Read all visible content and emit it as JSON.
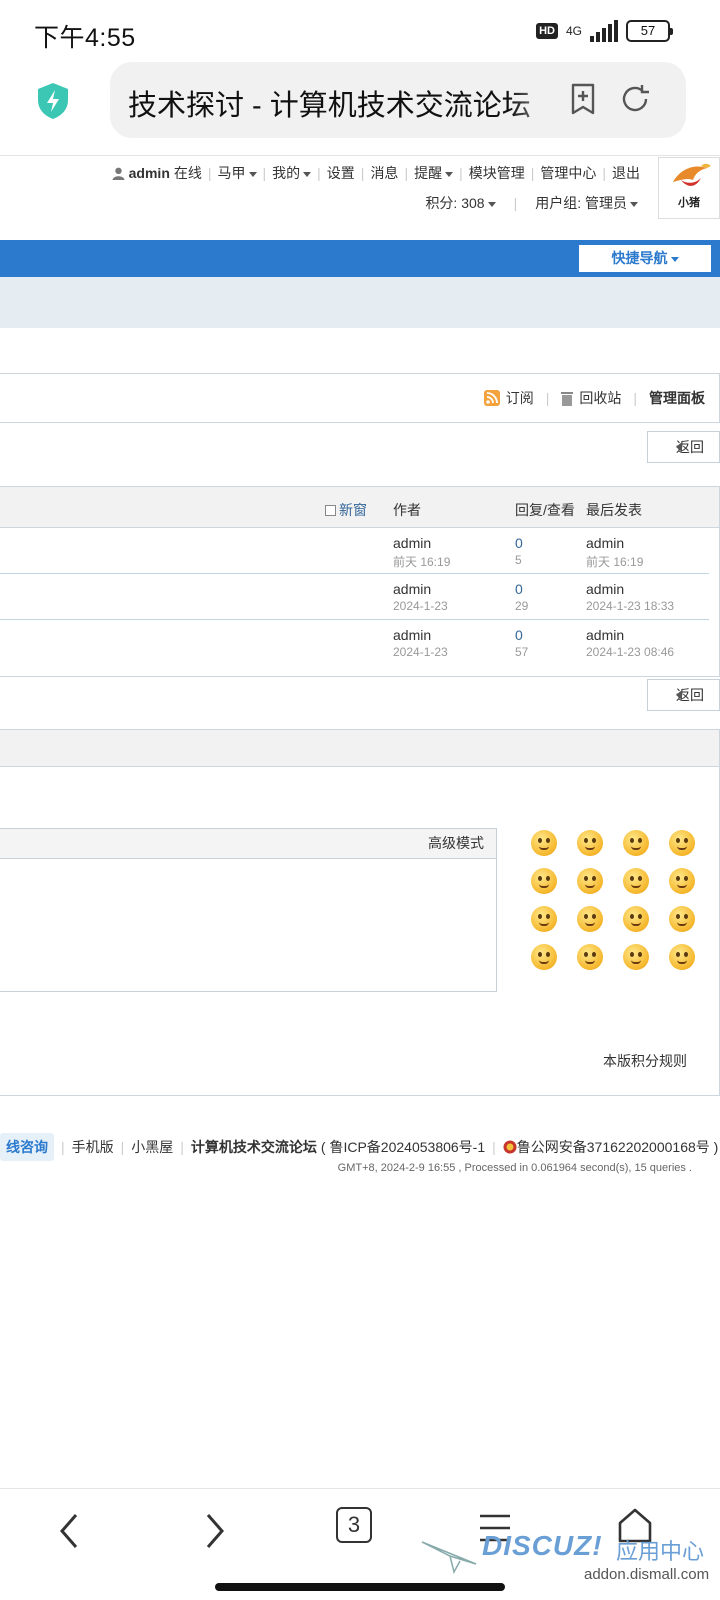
{
  "status_bar": {
    "time": "下午4:55",
    "hd": "HD",
    "network": "4G",
    "battery": "57"
  },
  "browser": {
    "url_title": "技术探讨 - 计算机技术交流论坛",
    "tab_count": "3"
  },
  "user_nav": {
    "username": "admin",
    "online": "在线",
    "items": [
      "马甲",
      "我的",
      "设置",
      "消息",
      "提醒",
      "模块管理",
      "管理中心",
      "退出"
    ],
    "points": "积分: 308",
    "usergroup": "用户组: 管理员"
  },
  "logo": {
    "text": "小猪"
  },
  "nav": {
    "quick_nav": "快捷导航"
  },
  "toolbar": {
    "subscribe": "订阅",
    "recycle": "回收站",
    "admin_panel": "管理面板"
  },
  "back_label": "返回",
  "thread_table": {
    "header": {
      "new_window": "新窗",
      "author": "作者",
      "reply_view": "回复/查看",
      "last_post": "最后发表"
    },
    "rows": [
      {
        "author": "admin",
        "author_date": "前天 16:19",
        "replies": "0",
        "views": "5",
        "last_author": "admin",
        "last_date": "前天 16:19"
      },
      {
        "author": "admin",
        "author_date": "2024-1-23",
        "replies": "0",
        "views": "29",
        "last_author": "admin",
        "last_date": "2024-1-23 18:33"
      },
      {
        "author": "admin",
        "author_date": "2024-1-23",
        "replies": "0",
        "views": "57",
        "last_author": "admin",
        "last_date": "2024-1-23 08:46"
      }
    ]
  },
  "quick_reply": {
    "advanced_mode": "高级模式",
    "rules": "本版积分规则"
  },
  "footer": {
    "consult": "线咨询",
    "mobile": "手机版",
    "blackroom": "小黑屋",
    "site_name": "计算机技术交流论坛",
    "icp": "( 鲁ICP备2024053806号-1",
    "police": "鲁公网安备37162202000168号 )",
    "stats": "GMT+8, 2024-2-9 16:55 , Processed in 0.061964 second(s), 15 queries ."
  },
  "watermark": {
    "brand": "DISCUZ!",
    "cn": "应用中心",
    "url": "addon.dismall.com"
  },
  "colors": {
    "nav_blue": "#2b7acd",
    "light_band": "#e5edf2",
    "link": "#336699"
  },
  "icons": [
    "shield-icon",
    "bookmark-add-icon",
    "refresh-icon",
    "user-icon",
    "rss-icon",
    "trash-icon",
    "back-arrow-icon",
    "forward-arrow-icon",
    "tabs-icon",
    "menu-icon",
    "home-icon"
  ]
}
